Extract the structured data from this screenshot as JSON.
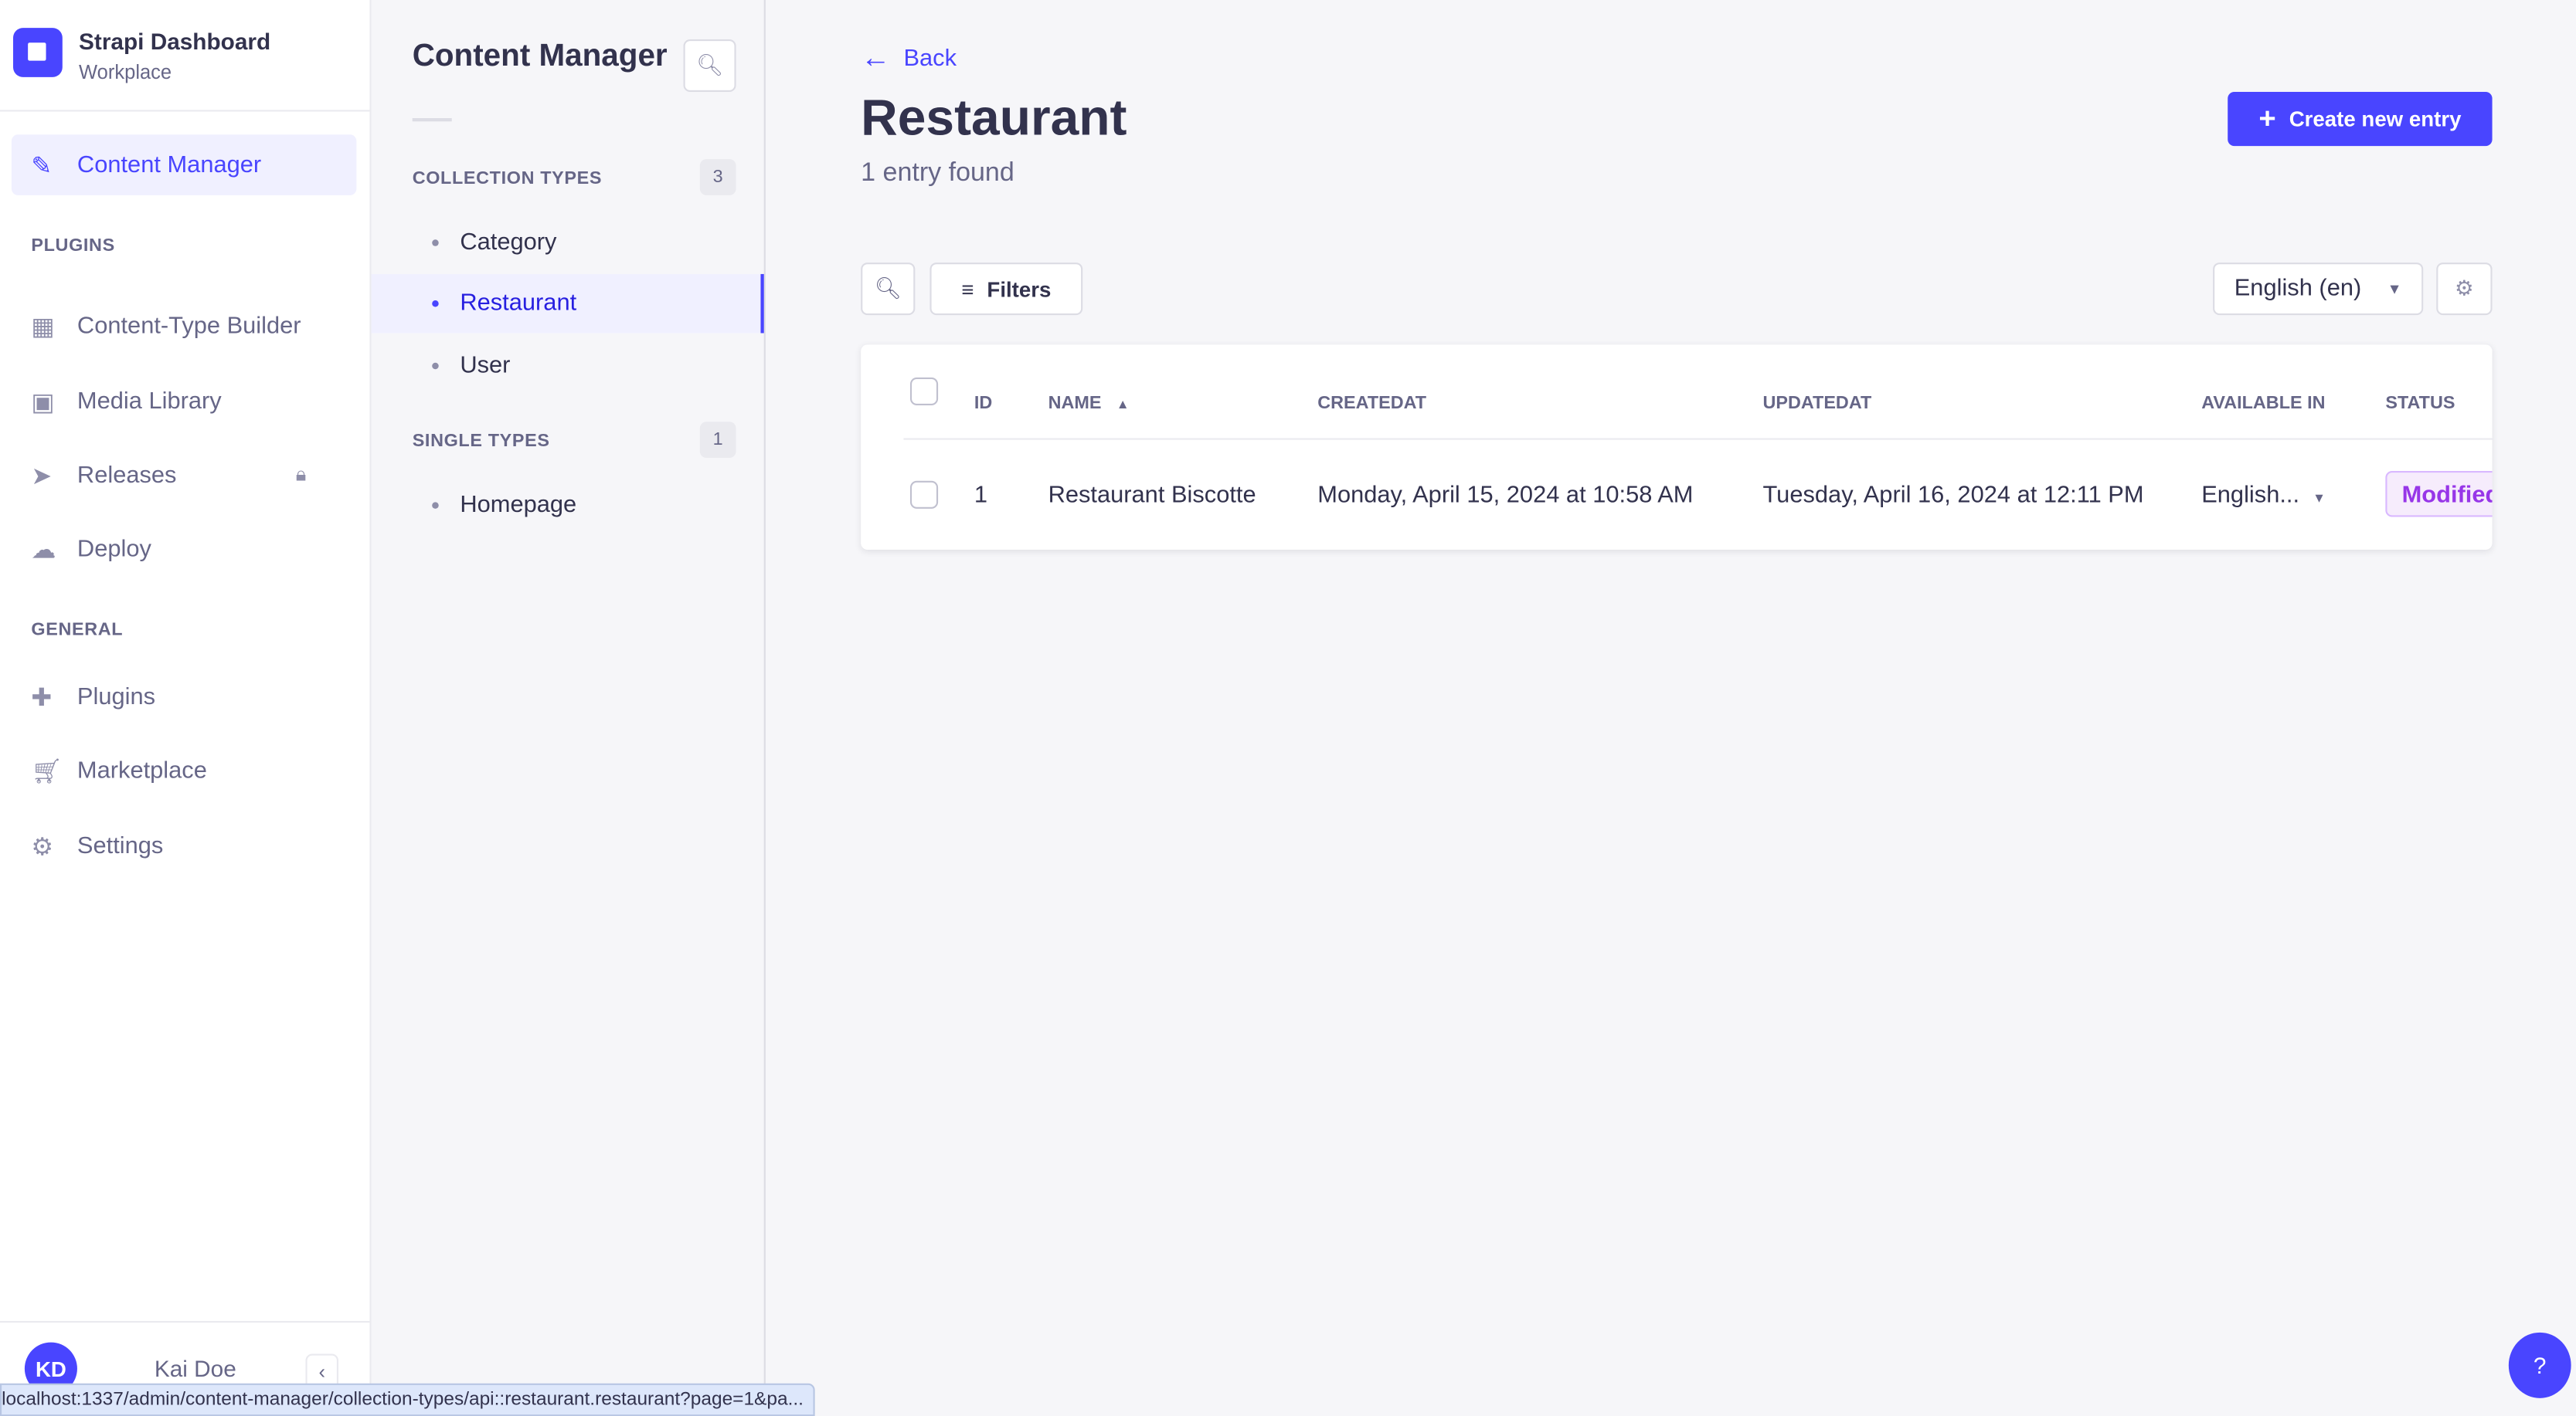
{
  "app": {
    "title": "Strapi Dashboard",
    "workspace": "Workplace"
  },
  "nav": {
    "content_manager": "Content Manager",
    "plugins_heading": "PLUGINS",
    "plugins": [
      {
        "label": "Content-Type Builder",
        "icon": "layout-icon"
      },
      {
        "label": "Media Library",
        "icon": "image-icon"
      },
      {
        "label": "Releases",
        "icon": "paper-plane-icon",
        "locked": true
      },
      {
        "label": "Deploy",
        "icon": "cloud-icon"
      }
    ],
    "general_heading": "GENERAL",
    "general": [
      {
        "label": "Plugins",
        "icon": "puzzle-icon"
      },
      {
        "label": "Marketplace",
        "icon": "cart-icon"
      },
      {
        "label": "Settings",
        "icon": "gear-icon"
      }
    ],
    "user": {
      "initials": "KD",
      "name": "Kai Doe"
    }
  },
  "sub": {
    "title": "Content Manager",
    "collection_heading": "COLLECTION TYPES",
    "collection_count": "3",
    "collections": [
      "Category",
      "Restaurant",
      "User"
    ],
    "single_heading": "SINGLE TYPES",
    "single_count": "1",
    "singles": [
      "Homepage"
    ],
    "active": "Restaurant"
  },
  "main": {
    "back": "Back",
    "title": "Restaurant",
    "subtitle": "1 entry found",
    "create": "Create new entry",
    "filters": "Filters",
    "locale": "English (en)",
    "columns": [
      "ID",
      "NAME",
      "CREATEDAT",
      "UPDATEDAT",
      "AVAILABLE IN",
      "STATUS"
    ],
    "rows": [
      {
        "id": "1",
        "name": "Restaurant Biscotte",
        "created": "Monday, April 15, 2024 at 10:58 AM",
        "updated": "Tuesday, April 16, 2024 at 12:11 PM",
        "available": "English...",
        "status": "Modified"
      }
    ]
  },
  "status_url": "localhost:1337/admin/content-manager/collection-types/api::restaurant.restaurant?page=1&pa...",
  "help": "?",
  "colors": {
    "accent": "#4945ff",
    "status_modified": "#9736e8"
  }
}
